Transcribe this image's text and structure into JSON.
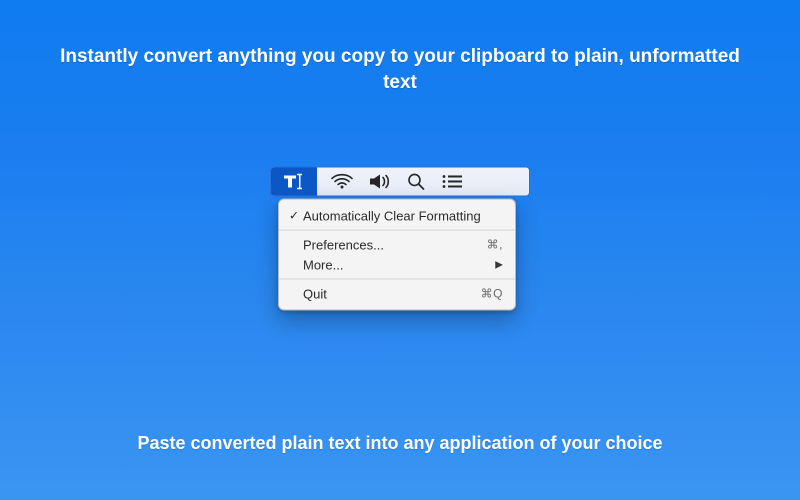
{
  "headline": "Instantly convert anything you copy to your clipboard to plain, unformatted text",
  "footline": "Paste converted plain text into any application of your choice",
  "menubar": {
    "app_icon": "text-cursor-icon",
    "status_icons": [
      "wifi-icon",
      "volume-icon",
      "search-icon",
      "list-icon"
    ]
  },
  "menu": {
    "items": [
      {
        "label": "Automatically Clear Formatting",
        "checked": true
      },
      {
        "label": "Preferences...",
        "shortcut": "⌘,"
      },
      {
        "label": "More...",
        "submenu": true
      },
      {
        "label": "Quit",
        "shortcut": "⌘Q"
      }
    ],
    "check_glyph": "✓",
    "submenu_glyph": "▶"
  }
}
